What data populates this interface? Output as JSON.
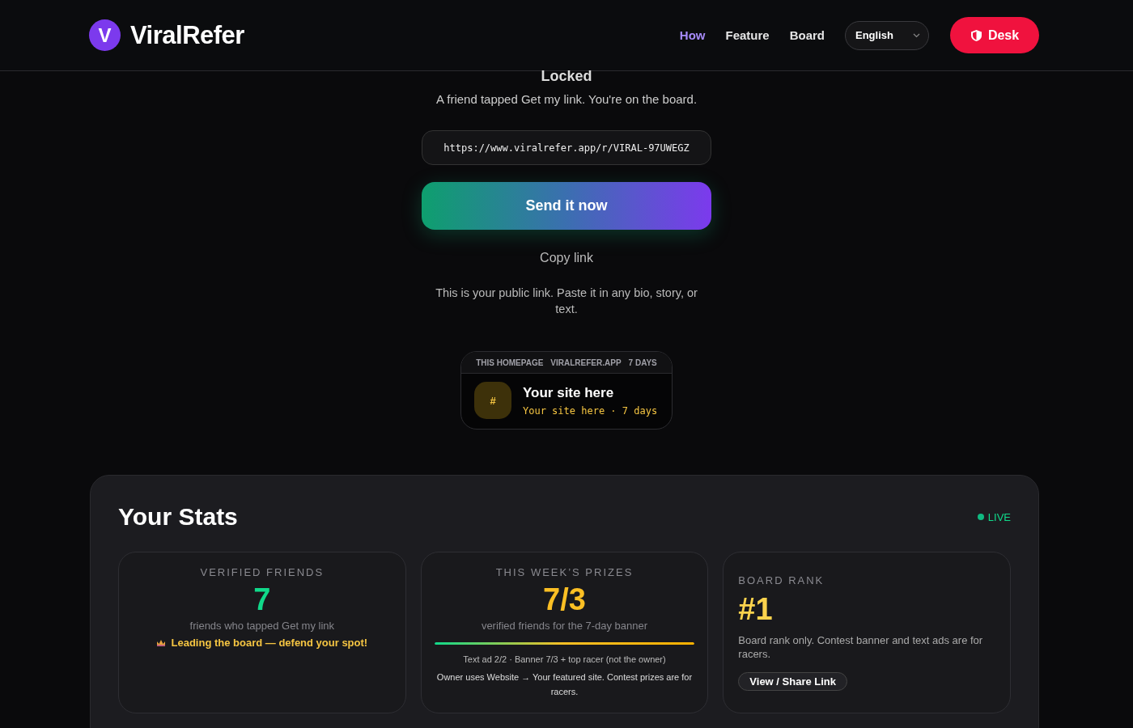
{
  "header": {
    "logo_letter": "V",
    "brand": "ViralRefer",
    "nav": [
      {
        "label": "How",
        "selected": true
      },
      {
        "label": "Feature",
        "selected": false
      },
      {
        "label": "Board",
        "selected": false
      }
    ],
    "language": "English",
    "desk_button": "Desk"
  },
  "hero": {
    "title": "Locked",
    "subtitle": "A friend tapped Get my link. You're on the board.",
    "link": "https://www.viralrefer.app/r/VIRAL-97UWEGZ",
    "send_button": "Send it now",
    "copy_link": "Copy link",
    "note": "This is your public link. Paste it in any bio, story, or text."
  },
  "ad_preview": {
    "tags": [
      "THIS HOMEPAGE",
      "VIRALREFER.APP",
      "7 DAYS"
    ],
    "badge": "#",
    "title": "Your site here",
    "subtitle": "Your site here · 7 days"
  },
  "stats": {
    "title": "Your Stats",
    "live": "LIVE",
    "verified": {
      "label": "VERIFIED FRIENDS",
      "value": "7",
      "caption": "friends who tapped Get my link",
      "note": "Leading the board — defend your spot!"
    },
    "prizes": {
      "label": "THIS WEEK’S PRIZES",
      "value": "7/3",
      "caption": "verified friends for the 7-day banner",
      "level": 1,
      "detail": "Text ad 2/2 · Banner 7/3 + top racer (not the owner)",
      "note": "Owner uses Website → Your featured site. Contest prizes are for racers."
    },
    "rank": {
      "label": "BOARD RANK",
      "value": "#1",
      "caption": "Board rank only. Contest banner and text ads are for racers.",
      "button": "View / Share Link"
    }
  }
}
